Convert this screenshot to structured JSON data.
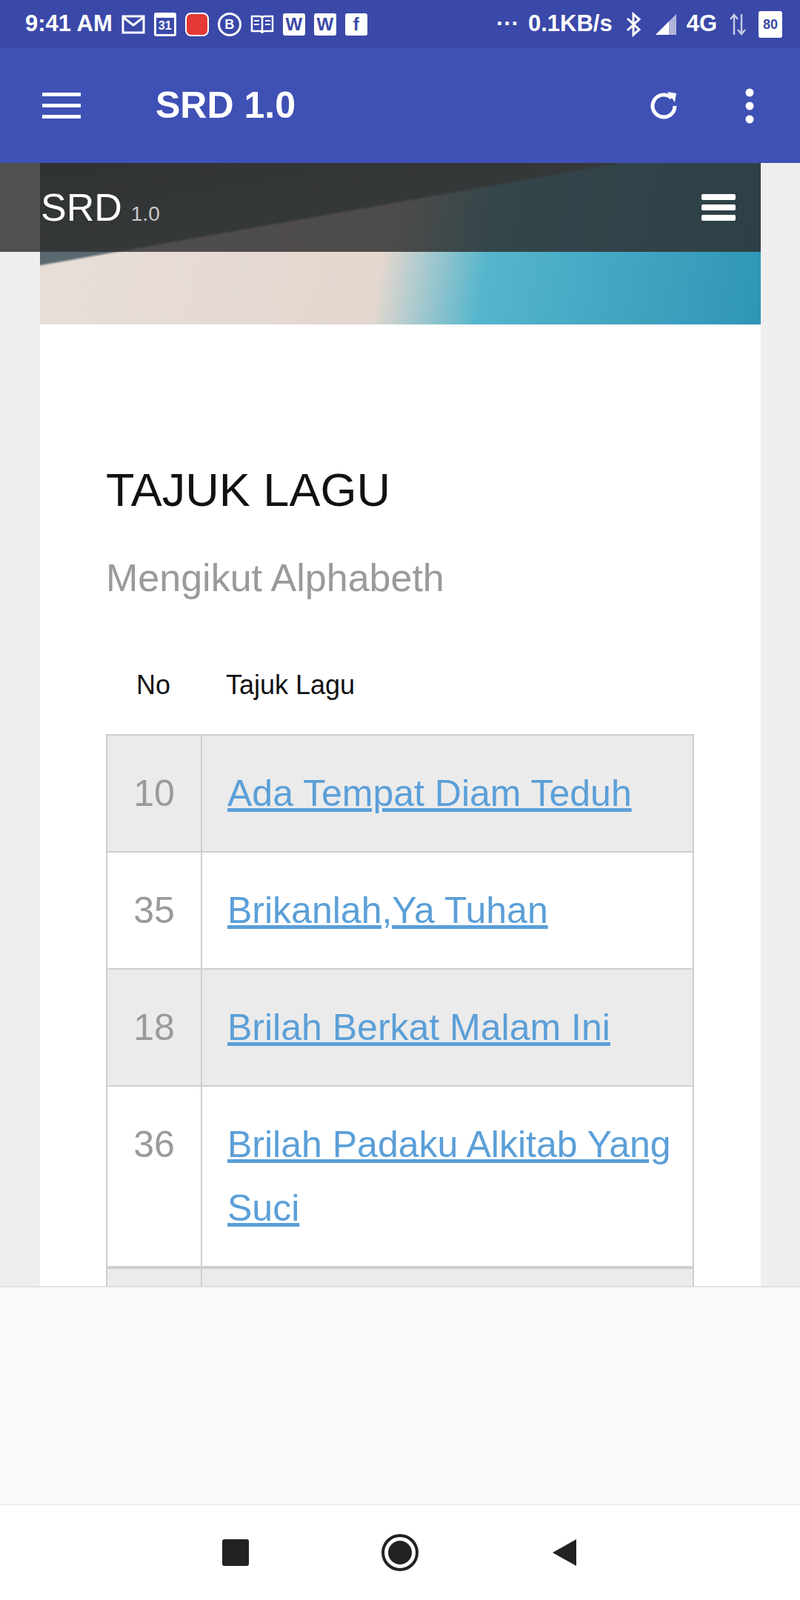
{
  "status_bar": {
    "time": "9:41 AM",
    "notifications": [
      {
        "kind": "mail"
      },
      {
        "kind": "calendar",
        "text": "31"
      },
      {
        "kind": "red-app"
      },
      {
        "kind": "circled",
        "text": "B"
      },
      {
        "kind": "book"
      },
      {
        "kind": "boxed",
        "text": "W"
      },
      {
        "kind": "boxed",
        "text": "W"
      },
      {
        "kind": "boxed",
        "text": "f"
      }
    ],
    "more": "···",
    "speed": "0.1KB/s",
    "network": "4G",
    "battery": "80"
  },
  "app_bar": {
    "title": "SRD 1.0"
  },
  "site_header": {
    "name": "SRD",
    "version": "1.0"
  },
  "page": {
    "title": "TAJUK LAGU",
    "subtitle": "Mengikut Alphabeth"
  },
  "table": {
    "columns": [
      "No",
      "Tajuk Lagu"
    ],
    "rows": [
      [
        "10",
        "Ada Tempat Diam Teduh"
      ],
      [
        "35",
        "Brikanlah,Ya Tuhan"
      ],
      [
        "18",
        "Brilah Berkat Malam Ini"
      ],
      [
        "36",
        "Brilah Padaku Alkitab Yang Suci"
      ]
    ]
  }
}
